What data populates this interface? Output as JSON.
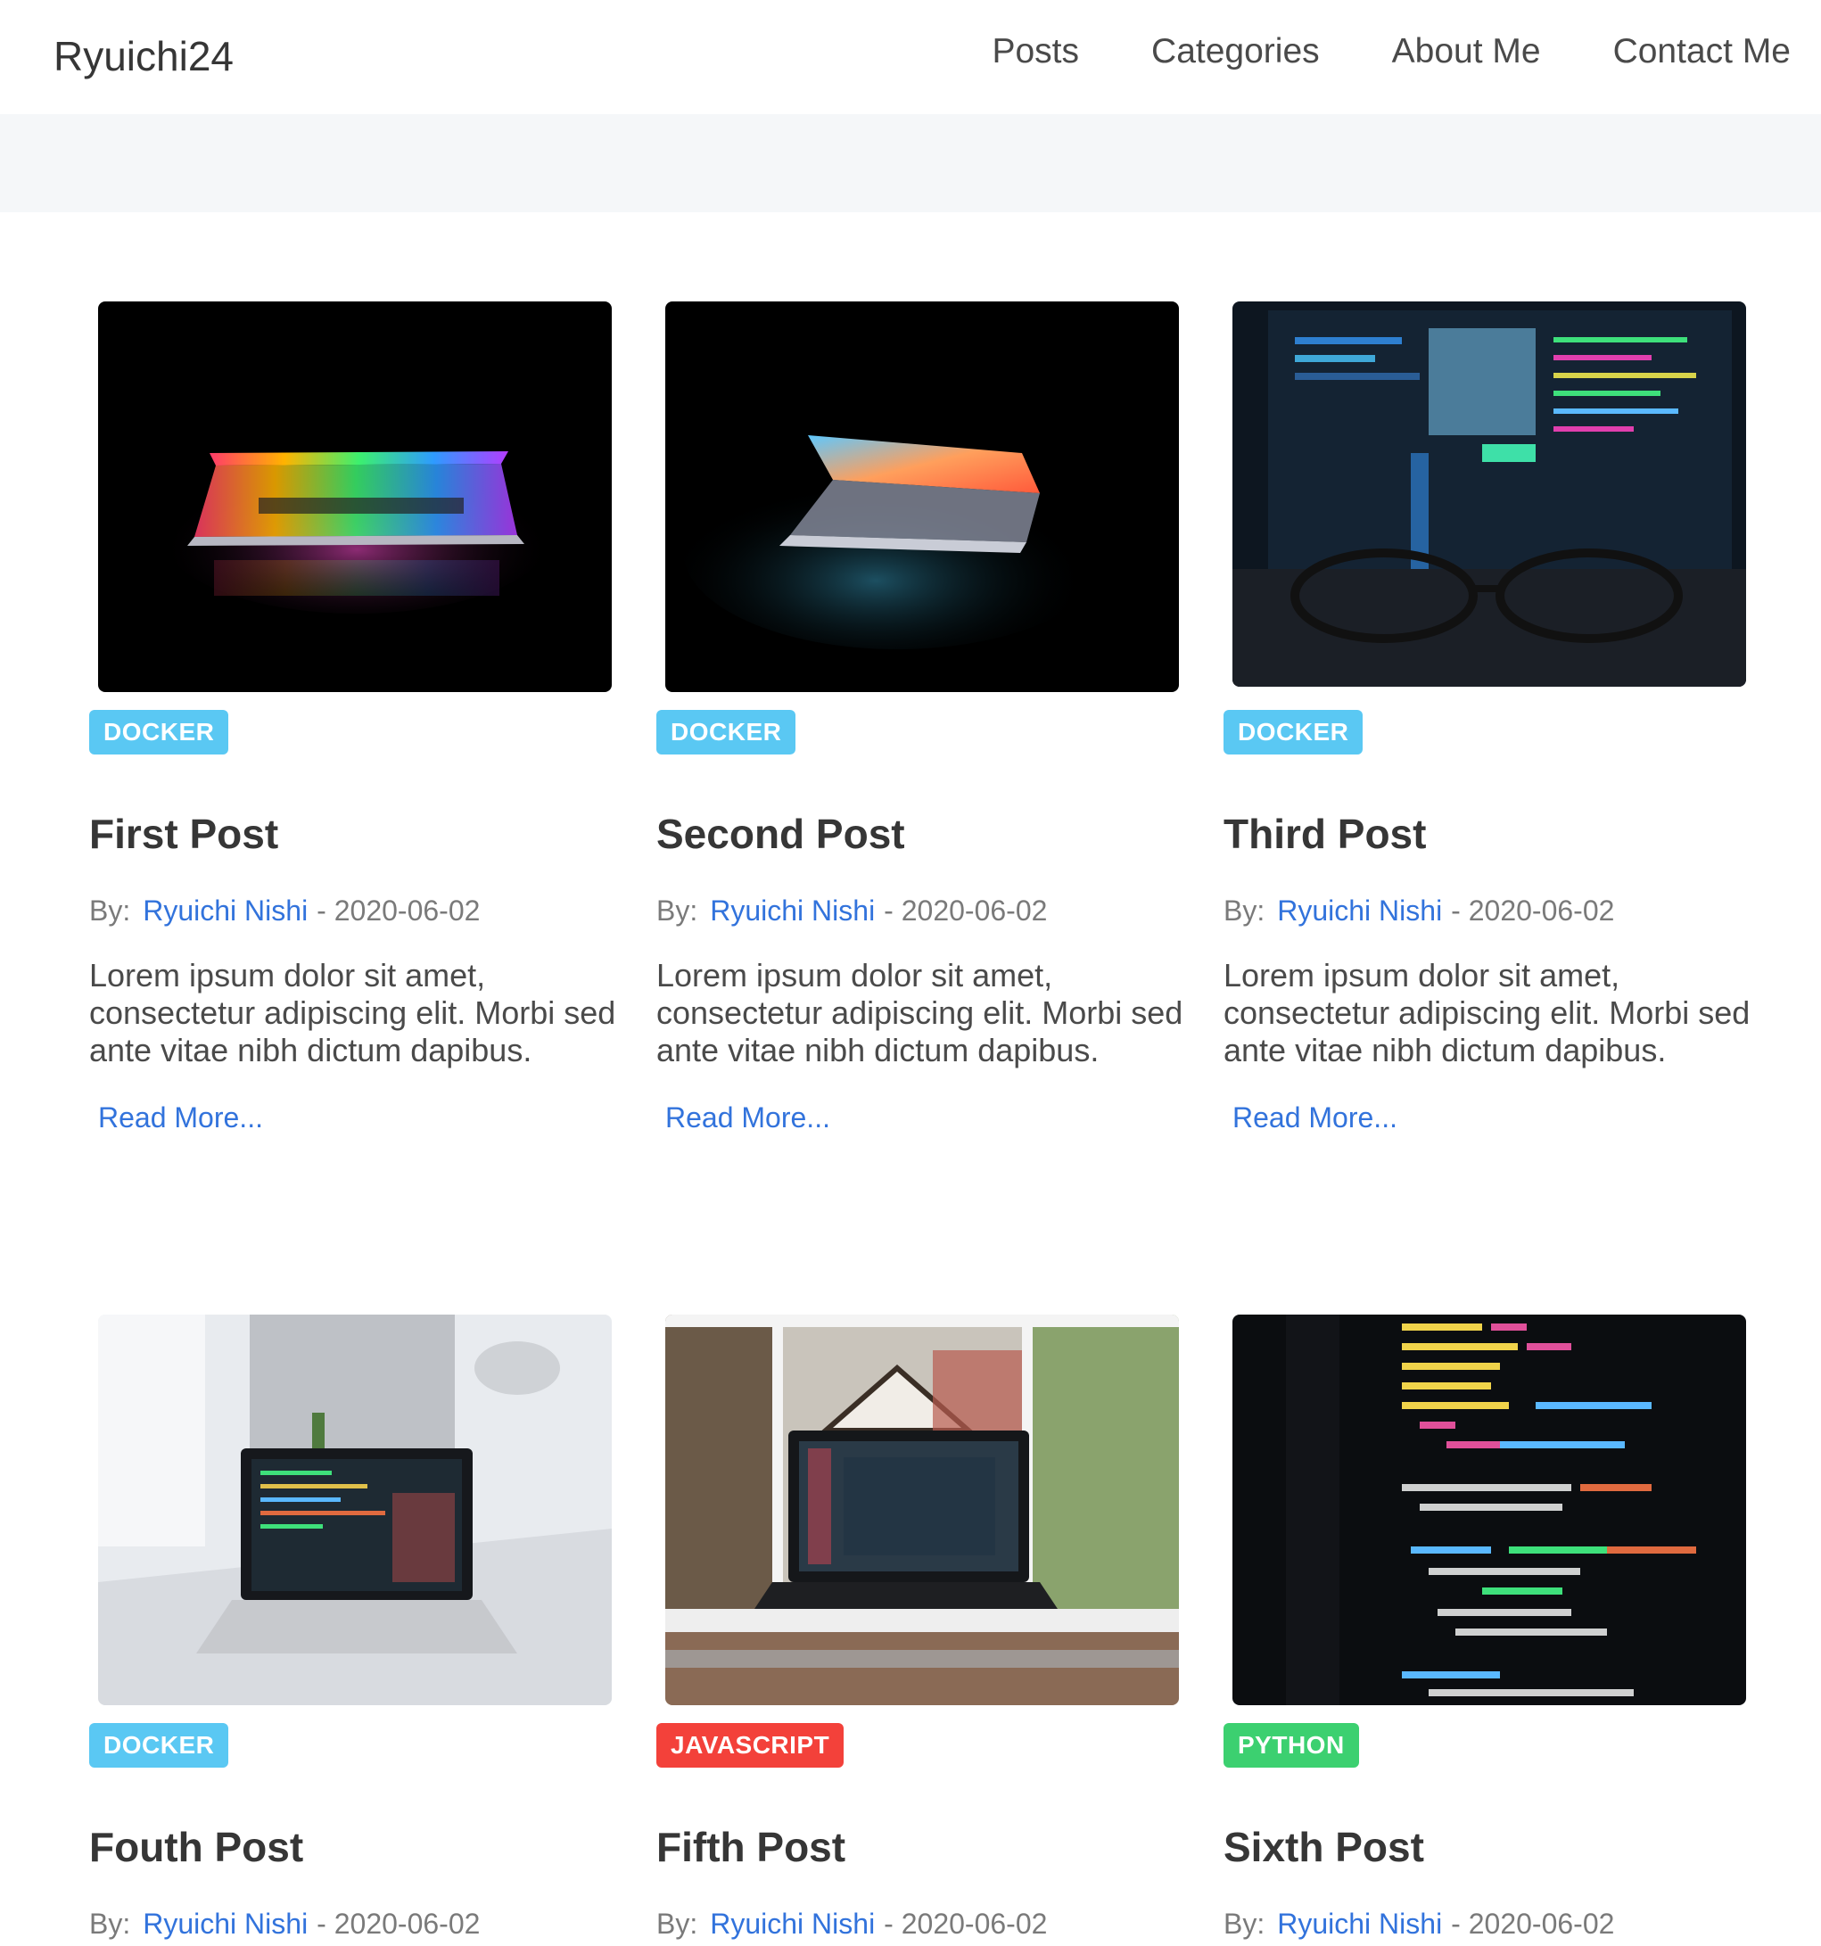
{
  "site": {
    "brand": "Ryuichi24",
    "nav": [
      "Posts",
      "Categories",
      "About Me",
      "Contact Me"
    ]
  },
  "posts": [
    {
      "tag": "DOCKER",
      "tag_color": "#5ac8f3",
      "image": "laptop-rainbow-keyboard-image",
      "title": "First Post",
      "by_label": "By:",
      "author": "Ryuichi Nishi",
      "date": "- 2020-06-02",
      "excerpt": "Lorem ipsum dolor sit amet, consectetur adipiscing elit. Morbi sed ante vitae nibh dictum dapibus.",
      "read_more": "Read More..."
    },
    {
      "tag": "DOCKER",
      "tag_color": "#5ac8f3",
      "image": "laptop-half-open-glow-image",
      "title": "Second Post",
      "by_label": "By:",
      "author": "Ryuichi Nishi",
      "date": "- 2020-06-02",
      "excerpt": "Lorem ipsum dolor sit amet, consectetur adipiscing elit. Morbi sed ante vitae nibh dictum dapibus.",
      "read_more": "Read More..."
    },
    {
      "tag": "DOCKER",
      "tag_color": "#5ac8f3",
      "image": "glasses-in-front-of-monitor-image",
      "title": "Third Post",
      "by_label": "By:",
      "author": "Ryuichi Nishi",
      "date": "- 2020-06-02",
      "excerpt": "Lorem ipsum dolor sit amet, consectetur adipiscing elit. Morbi sed ante vitae nibh dictum dapibus.",
      "read_more": "Read More..."
    },
    {
      "tag": "DOCKER",
      "tag_color": "#5ac8f3",
      "image": "laptop-on-desk-code-image",
      "title": "Fouth Post",
      "by_label": "By:",
      "author": "Ryuichi Nishi",
      "date": "- 2020-06-02",
      "excerpt": "",
      "read_more": ""
    },
    {
      "tag": "JAVASCRIPT",
      "tag_color": "#f3413a",
      "image": "laptop-by-window-image",
      "title": "Fifth Post",
      "by_label": "By:",
      "author": "Ryuichi Nishi",
      "date": "- 2020-06-02",
      "excerpt": "",
      "read_more": ""
    },
    {
      "tag": "PYTHON",
      "tag_color": "#3cd070",
      "image": "python-code-screen-image",
      "title": "Sixth Post",
      "by_label": "By:",
      "author": "Ryuichi Nishi",
      "date": "- 2020-06-02",
      "excerpt": "",
      "read_more": ""
    }
  ],
  "colors": {
    "link": "#3273dc",
    "docker": "#5ac8f3",
    "javascript": "#f3413a",
    "python": "#3cd070",
    "hero_band": "#f5f7f9"
  }
}
